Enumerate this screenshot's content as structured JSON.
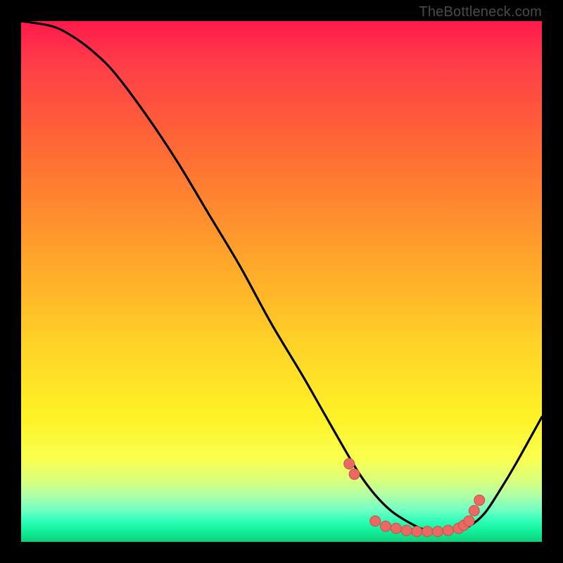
{
  "attribution": "TheBottleneck.com",
  "colors": {
    "gradient_top": "#ff1a4b",
    "gradient_bottom": "#0fcf76",
    "curve": "#000000",
    "marker_fill": "#e86a63",
    "marker_stroke": "#c94f49",
    "frame_bg": "#000000"
  },
  "chart_data": {
    "type": "line",
    "title": "",
    "xlabel": "",
    "ylabel": "",
    "xlim": [
      0,
      100
    ],
    "ylim": [
      0,
      100
    ],
    "grid": false,
    "legend": false,
    "series": [
      {
        "name": "bottleneck-curve",
        "x": [
          0,
          6,
          10,
          14,
          18,
          24,
          30,
          36,
          42,
          48,
          54,
          58,
          62,
          65,
          68,
          71,
          74,
          77,
          80,
          83,
          86,
          89,
          92,
          95,
          100
        ],
        "values": [
          100,
          99,
          97,
          94,
          90,
          82,
          73,
          63,
          53,
          42,
          32,
          25,
          18,
          13,
          9,
          6,
          4,
          2.5,
          2,
          2.2,
          3,
          5.5,
          10,
          15,
          24
        ]
      }
    ],
    "markers": {
      "name": "highlight-points",
      "x": [
        63,
        64,
        68,
        70,
        72,
        74,
        76,
        78,
        80,
        82,
        84,
        85,
        86,
        87,
        88
      ],
      "values": [
        15,
        13,
        4,
        3,
        2.6,
        2.2,
        2.0,
        2.0,
        2.0,
        2.2,
        2.6,
        3.2,
        4,
        6,
        8
      ]
    }
  }
}
